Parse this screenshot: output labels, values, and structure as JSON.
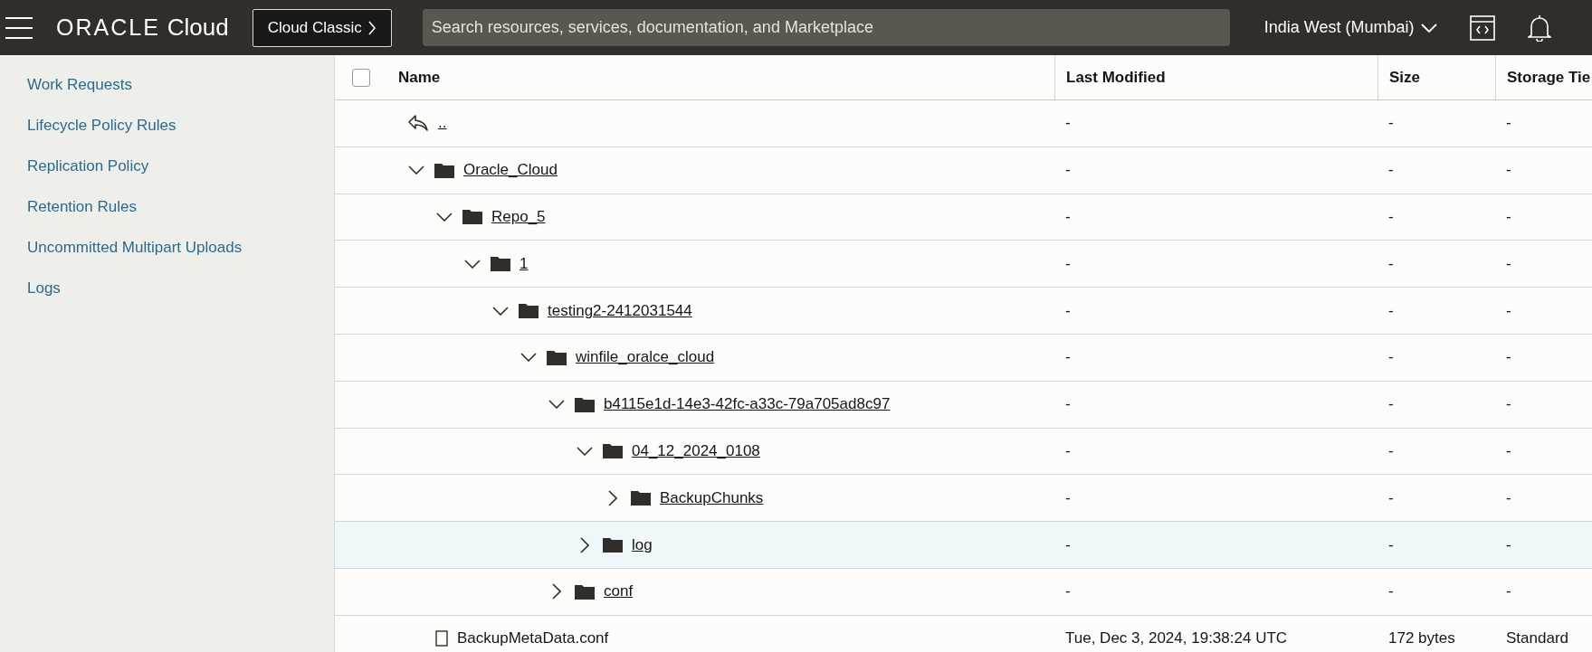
{
  "header": {
    "brand": "ORACLE",
    "brand_suffix": "Cloud",
    "classic_button": "Cloud Classic",
    "search": {
      "placeholder": "Search resources, services, documentation, and Marketplace"
    },
    "region": "India West (Mumbai)"
  },
  "sidebar": {
    "items": [
      "Work Requests",
      "Lifecycle Policy Rules",
      "Replication Policy",
      "Retention Rules",
      "Uncommitted Multipart Uploads",
      "Logs"
    ]
  },
  "table": {
    "select_all": {
      "checked": false
    },
    "columns": [
      "Name",
      "Last Modified",
      "Size",
      "Storage Tie"
    ],
    "parent_row": {
      "name": "..",
      "last_modified": "-",
      "size": "-",
      "storage_tier": "-"
    },
    "rows": [
      {
        "kind": "folder",
        "name": "Oracle_Cloud",
        "expanded": true,
        "highlighted": false,
        "last_modified": "-",
        "size": "-",
        "storage_tier": "-",
        "children": [
          {
            "kind": "folder",
            "name": "Repo_5",
            "expanded": true,
            "highlighted": false,
            "last_modified": "-",
            "size": "-",
            "storage_tier": "-",
            "children": [
              {
                "kind": "folder",
                "name": "1",
                "expanded": true,
                "highlighted": false,
                "last_modified": "-",
                "size": "-",
                "storage_tier": "-",
                "children": [
                  {
                    "kind": "folder",
                    "name": "testing2-2412031544",
                    "expanded": true,
                    "highlighted": false,
                    "last_modified": "-",
                    "size": "-",
                    "storage_tier": "-",
                    "children": [
                      {
                        "kind": "folder",
                        "name": "winfile_oralce_cloud",
                        "expanded": true,
                        "highlighted": false,
                        "last_modified": "-",
                        "size": "-",
                        "storage_tier": "-",
                        "children": [
                          {
                            "kind": "folder",
                            "name": "b4115e1d-14e3-42fc-a33c-79a705ad8c97",
                            "expanded": true,
                            "highlighted": false,
                            "last_modified": "-",
                            "size": "-",
                            "storage_tier": "-",
                            "children": [
                              {
                                "kind": "folder",
                                "name": "04_12_2024_0108",
                                "expanded": true,
                                "highlighted": false,
                                "last_modified": "-",
                                "size": "-",
                                "storage_tier": "-",
                                "children": [
                                  {
                                    "kind": "folder",
                                    "name": "BackupChunks",
                                    "expanded": false,
                                    "highlighted": false,
                                    "last_modified": "-",
                                    "size": "-",
                                    "storage_tier": "-"
                                  }
                                ]
                              },
                              {
                                "kind": "folder",
                                "name": "log",
                                "expanded": false,
                                "highlighted": true,
                                "last_modified": "-",
                                "size": "-",
                                "storage_tier": "-"
                              }
                            ]
                          },
                          {
                            "kind": "folder",
                            "name": "conf",
                            "expanded": false,
                            "highlighted": false,
                            "last_modified": "-",
                            "size": "-",
                            "storage_tier": "-"
                          }
                        ]
                      }
                    ]
                  }
                ]
              }
            ]
          },
          {
            "kind": "file",
            "name": "BackupMetaData.conf",
            "highlighted": false,
            "last_modified": "Tue, Dec 3, 2024, 19:38:24 UTC",
            "size": "172 bytes",
            "storage_tier": "Standard"
          }
        ]
      }
    ]
  }
}
